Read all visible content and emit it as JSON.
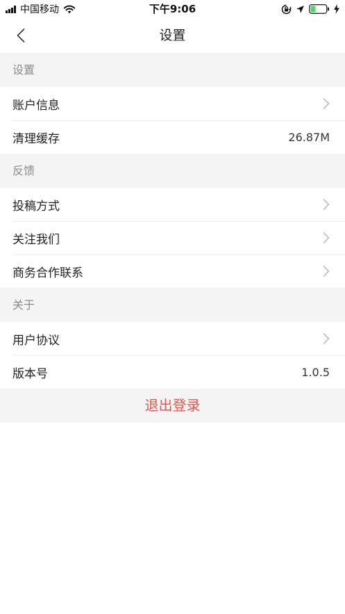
{
  "status_bar": {
    "carrier": "中国移动",
    "time": "下午9:06"
  },
  "nav": {
    "title": "设置"
  },
  "sections": [
    {
      "header": "设置",
      "items": [
        {
          "label": "账户信息",
          "value": ""
        },
        {
          "label": "清理缓存",
          "value": "26.87M"
        }
      ]
    },
    {
      "header": "反馈",
      "items": [
        {
          "label": "投稿方式",
          "value": ""
        },
        {
          "label": "关注我们",
          "value": ""
        },
        {
          "label": "商务合作联系",
          "value": ""
        }
      ]
    },
    {
      "header": "关于",
      "items": [
        {
          "label": "用户协议",
          "value": ""
        },
        {
          "label": "版本号",
          "value": "1.0.5"
        }
      ]
    }
  ],
  "logout_label": "退出登录",
  "colors": {
    "logout_text": "#e8564e",
    "section_bg": "#f4f4f4",
    "battery_fill": "#4cd964"
  },
  "icons": {
    "back": "chevron-left-icon",
    "row_arrow": "chevron-right-icon",
    "wifi": "wifi-icon",
    "orientation_lock": "orientation-lock-icon",
    "location": "location-arrow-icon",
    "battery": "battery-icon",
    "charging": "charging-bolt-icon"
  }
}
